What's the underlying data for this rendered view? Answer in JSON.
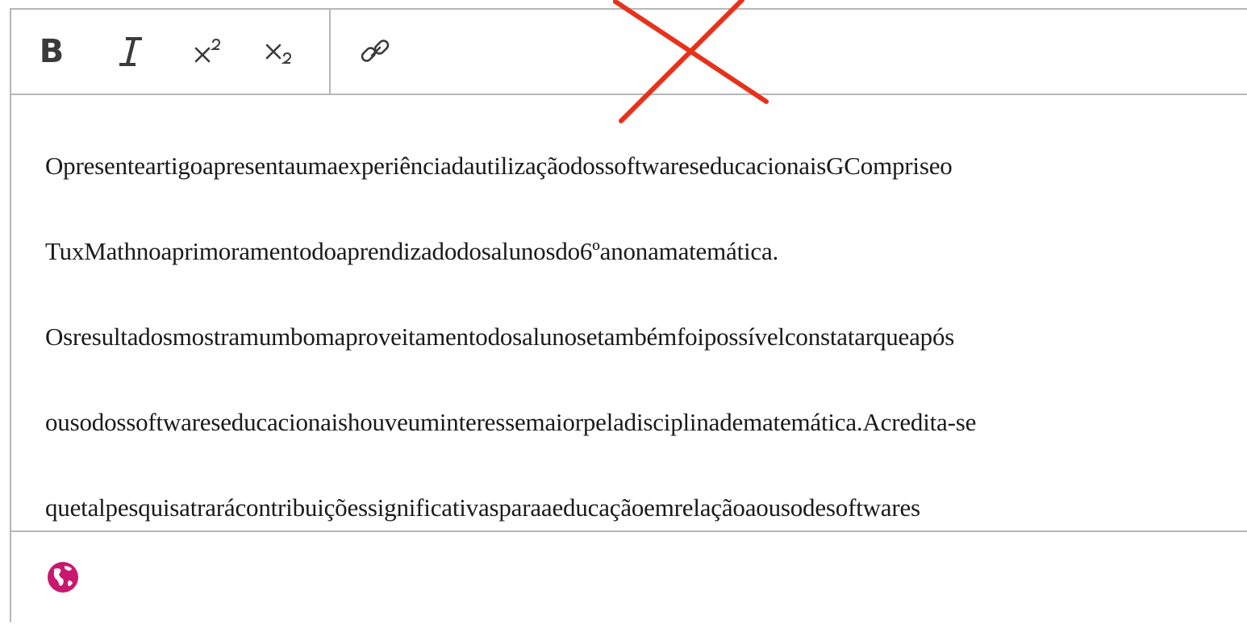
{
  "toolbar": {
    "buttons": [
      {
        "name": "bold-button",
        "icon": "bold-icon"
      },
      {
        "name": "italic-button",
        "icon": "italic-icon"
      },
      {
        "name": "superscript-button",
        "icon": "superscript-icon"
      },
      {
        "name": "subscript-button",
        "icon": "subscript-icon"
      },
      {
        "name": "link-button",
        "icon": "link-icon"
      }
    ],
    "bold_glyph": "B"
  },
  "content": {
    "lines": [
      "OpresenteartigoapresentaumaexperiênciadautilizaçãodossoftwareseducacionaisGCompriseo",
      "TuxMathnoaprimoramentodoaprendizadodosalunosdo6ºanonamatemática.",
      "Osresultadosmostramumbomaproveitamentodosalunosetambémfoipossívelconstatarqueapós",
      "ousodossoftwareseducacionaishouveuminteressemaiorpeladisciplinadematemática.Acredita-se",
      "quetalpesquisatrarácontribuiçõessignificativasparaaeducaçãoemrelaçãoaousodesoftwares"
    ]
  },
  "statusbar": {
    "icon": "globe-icon",
    "icon_color": "#c8196e"
  },
  "annotation": {
    "icon": "red-cross-mark",
    "color": "#e8311a"
  },
  "colors": {
    "border": "#b7b7b7",
    "toolbar_icon": "#3b3b3b",
    "text": "#1a1a1a"
  }
}
